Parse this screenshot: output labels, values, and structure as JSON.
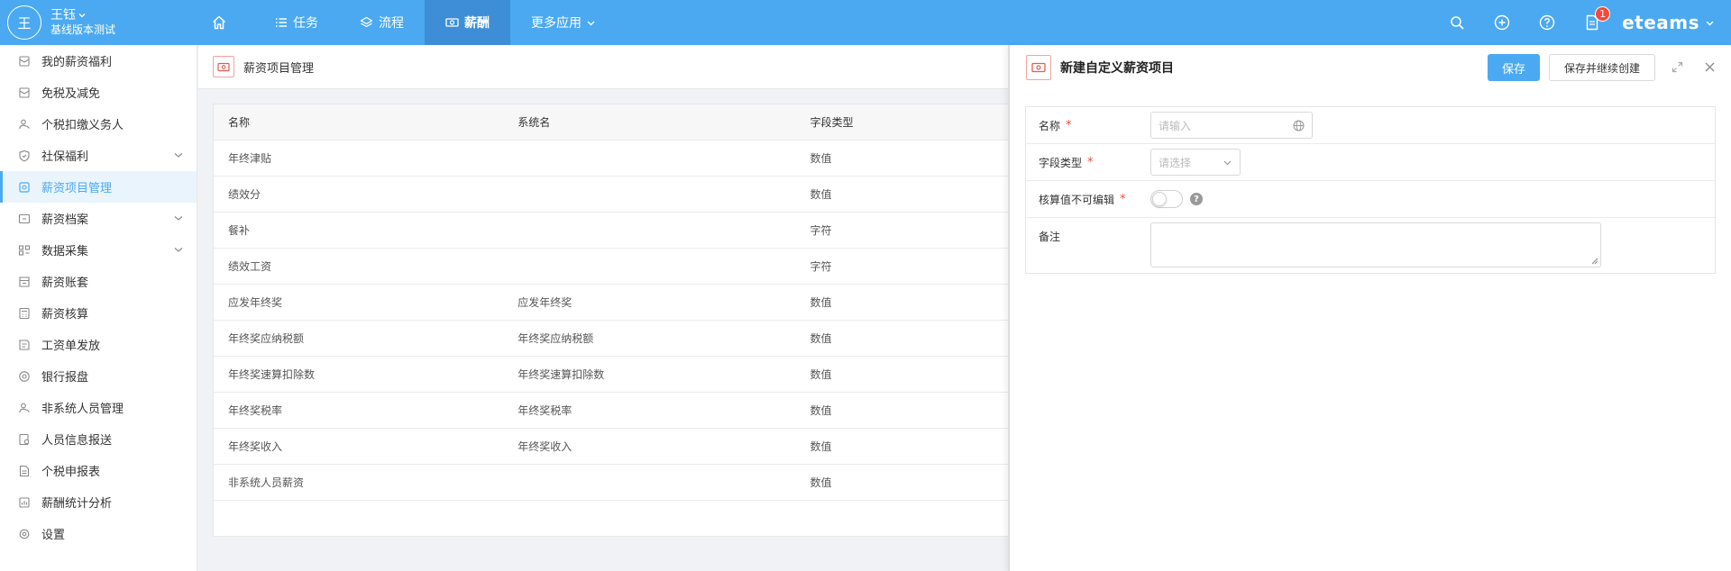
{
  "user": {
    "avatar_initial": "王",
    "name": "王钰",
    "org": "基线版本测试"
  },
  "nav": {
    "items": [
      {
        "label": "任务"
      },
      {
        "label": "流程"
      },
      {
        "label": "薪酬"
      },
      {
        "label": "更多应用"
      }
    ],
    "active_index": 2
  },
  "topright": {
    "notification_count": "1",
    "brand": "eteams"
  },
  "sidebar": {
    "items": [
      {
        "label": "我的薪资福利",
        "icon": "envelope-icon"
      },
      {
        "label": "免税及减免",
        "icon": "envelope-icon"
      },
      {
        "label": "个税扣缴义务人",
        "icon": "person-icon"
      },
      {
        "label": "社保福利",
        "icon": "shield-icon",
        "expandable": true
      },
      {
        "label": "薪资项目管理",
        "icon": "salary-item-icon",
        "active": true
      },
      {
        "label": "薪资档案",
        "icon": "archive-icon",
        "expandable": true
      },
      {
        "label": "数据采集",
        "icon": "data-collect-icon",
        "expandable": true
      },
      {
        "label": "薪资账套",
        "icon": "ledger-icon"
      },
      {
        "label": "薪资核算",
        "icon": "calculator-icon"
      },
      {
        "label": "工资单发放",
        "icon": "payslip-icon"
      },
      {
        "label": "银行报盘",
        "icon": "at-icon"
      },
      {
        "label": "非系统人员管理",
        "icon": "person-icon"
      },
      {
        "label": "人员信息报送",
        "icon": "report-icon"
      },
      {
        "label": "个税申报表",
        "icon": "doc-icon"
      },
      {
        "label": "薪酬统计分析",
        "icon": "chart-icon"
      },
      {
        "label": "设置",
        "icon": "gear-icon"
      }
    ]
  },
  "main": {
    "title": "薪资项目管理",
    "table": {
      "headers": [
        "名称",
        "系统名",
        "字段类型"
      ],
      "rows": [
        [
          "年终津贴",
          "",
          "数值"
        ],
        [
          "绩效分",
          "",
          "数值"
        ],
        [
          "餐补",
          "",
          "字符"
        ],
        [
          "绩效工资",
          "",
          "字符"
        ],
        [
          "应发年终奖",
          "应发年终奖",
          "数值"
        ],
        [
          "年终奖应纳税额",
          "年终奖应纳税额",
          "数值"
        ],
        [
          "年终奖速算扣除数",
          "年终奖速算扣除数",
          "数值"
        ],
        [
          "年终奖税率",
          "年终奖税率",
          "数值"
        ],
        [
          "年终奖收入",
          "年终奖收入",
          "数值"
        ],
        [
          "非系统人员薪资",
          "",
          "数值"
        ]
      ]
    }
  },
  "drawer": {
    "title": "新建自定义薪资项目",
    "save_label": "保存",
    "save_continue_label": "保存并继续创建",
    "form": {
      "name_label": "名称",
      "name_placeholder": "请输入",
      "type_label": "字段类型",
      "type_placeholder": "请选择",
      "noneditable_label": "核算值不可编辑",
      "noneditable_value": false,
      "remark_label": "备注",
      "required_mark": "*"
    }
  }
}
